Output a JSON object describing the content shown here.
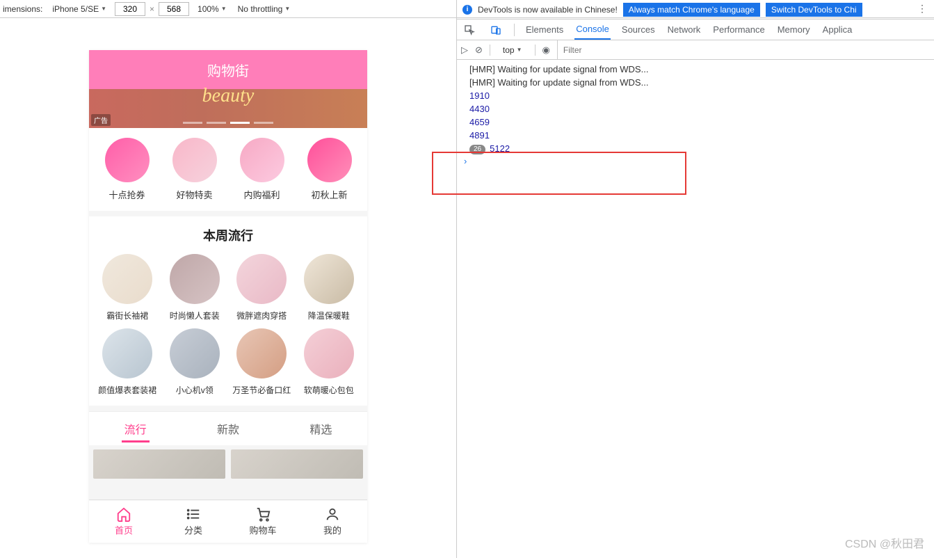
{
  "toolbar": {
    "dimensions_label": "imensions:",
    "device": "iPhone 5/SE",
    "width": "320",
    "height": "568",
    "zoom": "100%",
    "throttling": "No throttling"
  },
  "phone": {
    "title": "购物街",
    "banner_script": "beauty",
    "ad_tag": "广告",
    "quick_links": [
      "十点抢券",
      "好物特卖",
      "内购福利",
      "初秋上新"
    ],
    "section_title": "本周流行",
    "popular": [
      "霸街长袖裙",
      "时尚懒人套装",
      "微胖遮肉穿搭",
      "降温保暖鞋",
      "颜值爆表套装裙",
      "小心机v领",
      "万圣节必备口红",
      "软萌暖心包包"
    ],
    "tabs": [
      "流行",
      "新款",
      "精选"
    ],
    "nav": [
      "首页",
      "分类",
      "购物车",
      "我的"
    ]
  },
  "devtools": {
    "info_text": "DevTools is now available in Chinese!",
    "btn1": "Always match Chrome's language",
    "btn2": "Switch DevTools to Chi",
    "tabs": [
      "Elements",
      "Console",
      "Sources",
      "Network",
      "Performance",
      "Memory",
      "Applica"
    ],
    "context": "top",
    "filter_placeholder": "Filter",
    "logs": [
      {
        "text": "[HMR] Waiting for update signal from WDS...",
        "type": "text"
      },
      {
        "text": "[HMR] Waiting for update signal from WDS...",
        "type": "text"
      },
      {
        "text": "1910",
        "type": "num"
      },
      {
        "text": "4430",
        "type": "num"
      },
      {
        "text": "4659",
        "type": "num"
      },
      {
        "text": "4891",
        "type": "num"
      },
      {
        "text": "5122",
        "type": "num",
        "badge": "26"
      }
    ],
    "prompt": "›"
  },
  "watermark": "CSDN @秋田君"
}
